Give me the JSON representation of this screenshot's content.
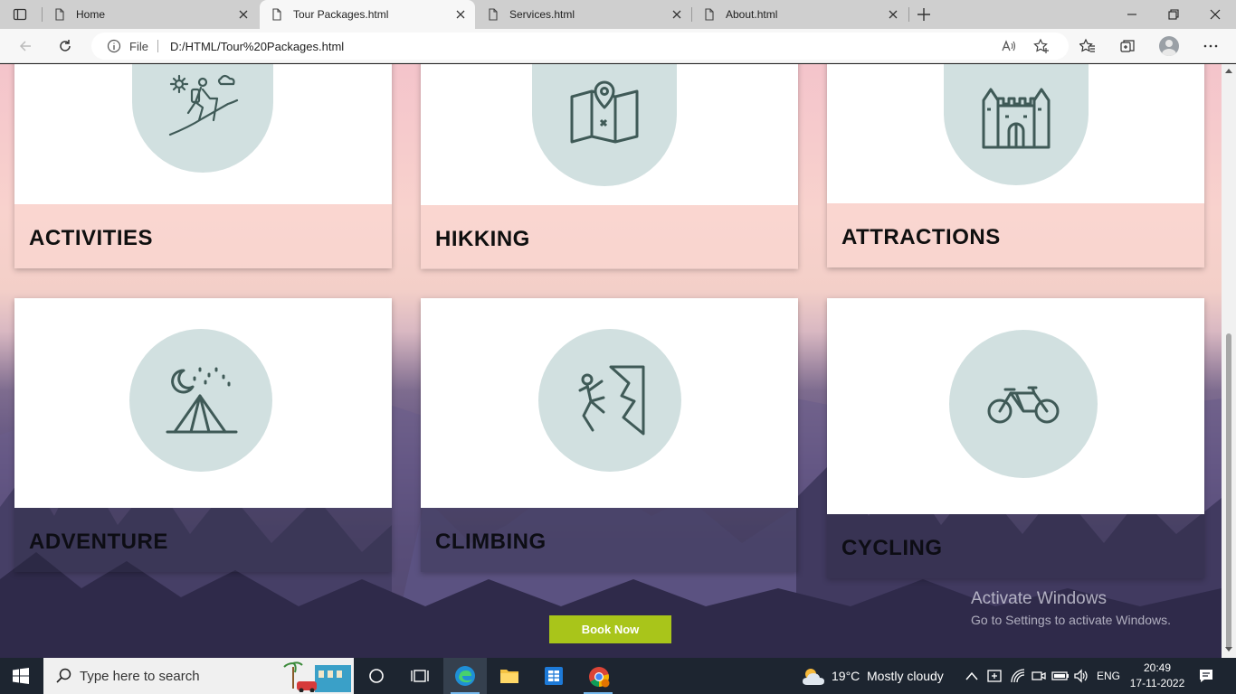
{
  "browser": {
    "tabs": [
      {
        "title": "Home"
      },
      {
        "title": "Tour Packages.html"
      },
      {
        "title": "Services.html"
      },
      {
        "title": "About.html"
      }
    ],
    "active_tab": 1,
    "address": {
      "scheme_label": "File",
      "url": "D:/HTML/Tour%20Packages.html"
    }
  },
  "page": {
    "cards": [
      {
        "title": "ACTIVITIES",
        "icon": "hiker-icon"
      },
      {
        "title": "HIKKING",
        "icon": "map-pin-icon"
      },
      {
        "title": "ATTRACTIONS",
        "icon": "castle-icon"
      },
      {
        "title": "ADVENTURE",
        "icon": "tent-icon"
      },
      {
        "title": "CLIMBING",
        "icon": "climber-icon"
      },
      {
        "title": "CYCLING",
        "icon": "bicycle-icon"
      }
    ],
    "book_button": "Book Now",
    "watermark": {
      "title": "Activate Windows",
      "subtitle": "Go to Settings to activate Windows."
    }
  },
  "taskbar": {
    "search_placeholder": "Type here to search",
    "weather": {
      "temp": "19°C",
      "condition": "Mostly cloudy"
    },
    "language": "ENG",
    "time": "20:49",
    "date": "17-11-2022"
  },
  "colors": {
    "accent_button": "#a9c51a",
    "icon_circle": "#d1e0e0",
    "icon_stroke": "#3f5a57"
  }
}
